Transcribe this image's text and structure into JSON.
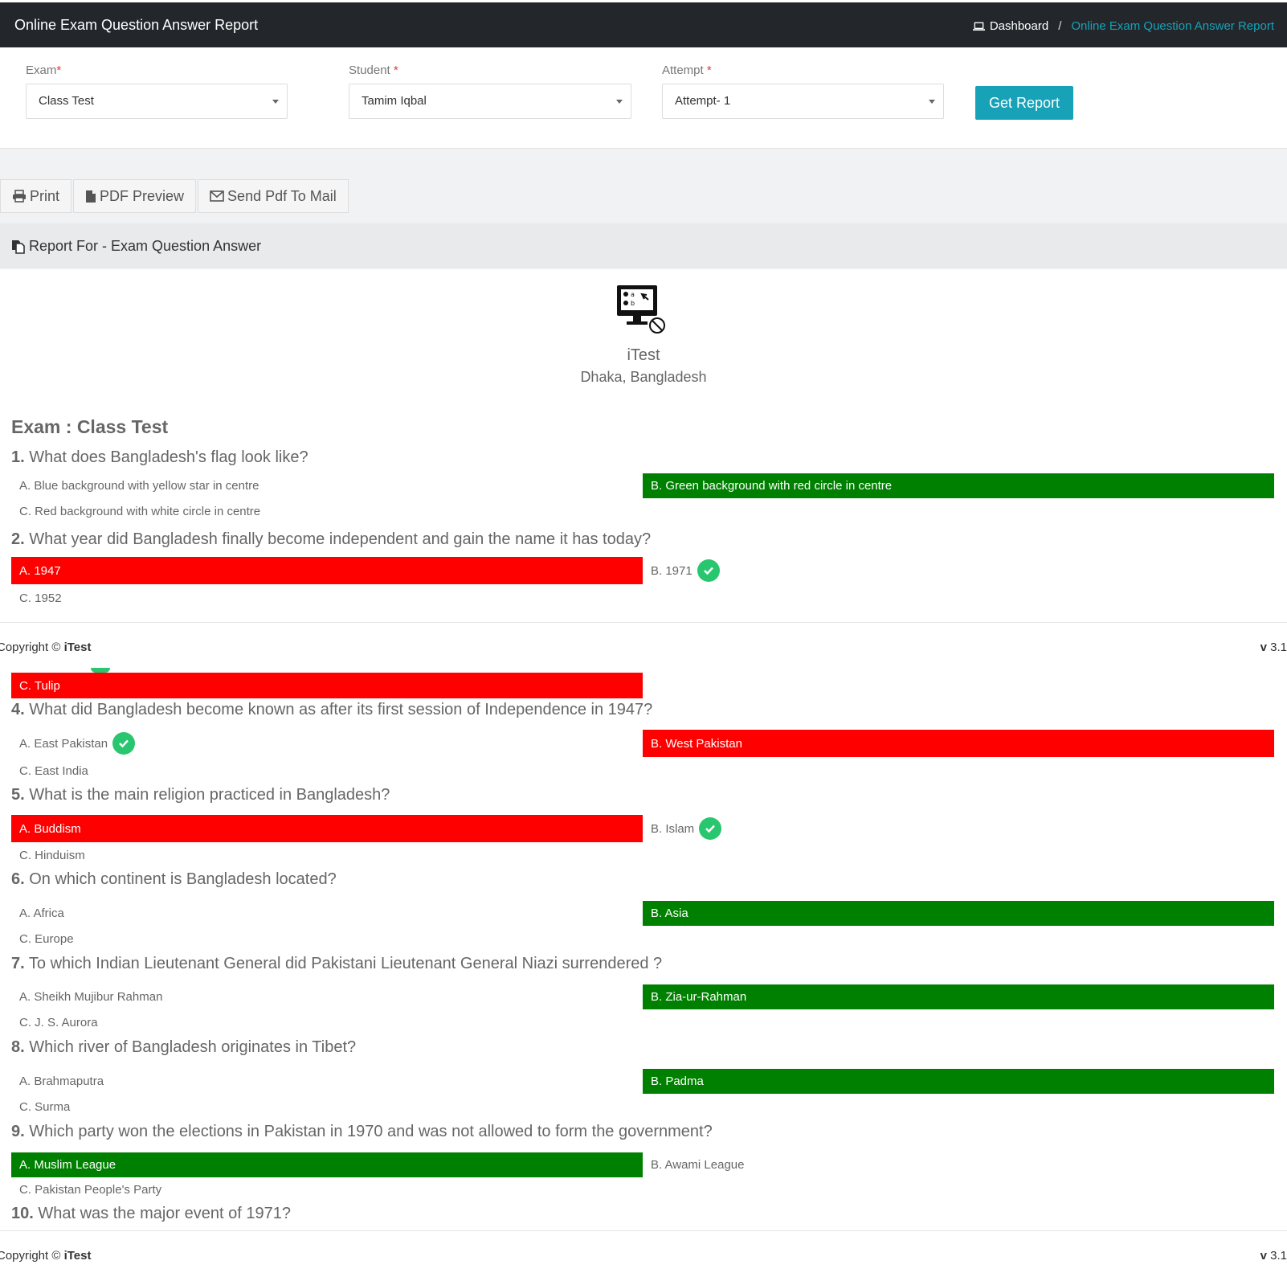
{
  "header": {
    "title": "Online Exam Question Answer Report",
    "breadcrumb_home": "Dashboard",
    "breadcrumb_sep": "/",
    "breadcrumb_current": "Online Exam Question Answer Report"
  },
  "filters": {
    "exam_label": "Exam",
    "exam_value": "Class Test",
    "student_label": "Student",
    "student_value": "Tamim Iqbal",
    "attempt_label": "Attempt",
    "attempt_value": "Attempt- 1",
    "required_mark": "*",
    "get_report": "Get Report"
  },
  "toolbar": {
    "print": "Print",
    "pdf_preview": "PDF Preview",
    "send_mail": "Send Pdf To Mail"
  },
  "report": {
    "heading": "Report For - Exam Question Answer",
    "org_name": "iTest",
    "org_address": "Dhaka, Bangladesh",
    "exam_title": "Exam : Class Test"
  },
  "questions": [
    {
      "num": "1.",
      "text": "What does Bangladesh's flag look like?",
      "a": "A. Blue background with yellow star in centre",
      "b": "B. Green background with red circle in centre",
      "c": "C. Red background with white circle in centre"
    },
    {
      "num": "2.",
      "text": "What year did Bangladesh finally become independent and gain the name it has today?",
      "a": "A. 1947",
      "b": "B. 1971",
      "c": "C. 1952"
    },
    {
      "c": "C. Tulip"
    },
    {
      "num": "4.",
      "text": "What did Bangladesh become known as after its first session of Independence in 1947?",
      "a": "A. East Pakistan",
      "b": "B. West Pakistan",
      "c": "C. East India"
    },
    {
      "num": "5.",
      "text": "What is the main religion practiced in Bangladesh?",
      "a": "A. Buddism",
      "b": "B. Islam",
      "c": "C. Hinduism"
    },
    {
      "num": "6.",
      "text": "On which continent is Bangladesh located?",
      "a": "A. Africa",
      "b": "B. Asia",
      "c": "C. Europe"
    },
    {
      "num": "7.",
      "text": "To which Indian Lieutenant General did Pakistani Lieutenant General Niazi surrendered ?",
      "a": "A. Sheikh Mujibur Rahman",
      "b": "B. Zia-ur-Rahman",
      "c": "C. J. S. Aurora"
    },
    {
      "num": "8.",
      "text": "Which river of Bangladesh originates in Tibet?",
      "a": "A. Brahmaputra",
      "b": "B. Padma",
      "c": "C. Surma"
    },
    {
      "num": "9.",
      "text": "Which party won the elections in Pakistan in 1970 and was not allowed to form the government?",
      "a": "A. Muslim League",
      "b": "B. Awami League",
      "c": "C. Pakistan People's Party"
    },
    {
      "num": "10.",
      "text": "What was the major event of 1971?"
    }
  ],
  "footer": {
    "copyright_prefix": "Copyright ©",
    "copyright_brand": "iTest",
    "version_prefix": "v",
    "version": "3.1"
  },
  "colors": {
    "correct": "#008000",
    "wrong": "#ff0000",
    "check": "#28c76f",
    "accent": "#17a2b8",
    "topbar": "#23272b"
  },
  "icons": {
    "dashboard": "laptop-icon",
    "print": "printer-icon",
    "pdf": "file-icon",
    "mail": "envelope-icon",
    "report": "copy-icon",
    "logo": "monitor-quiz-icon",
    "correct": "check-circle-icon",
    "dropdown": "caret-down-icon"
  }
}
